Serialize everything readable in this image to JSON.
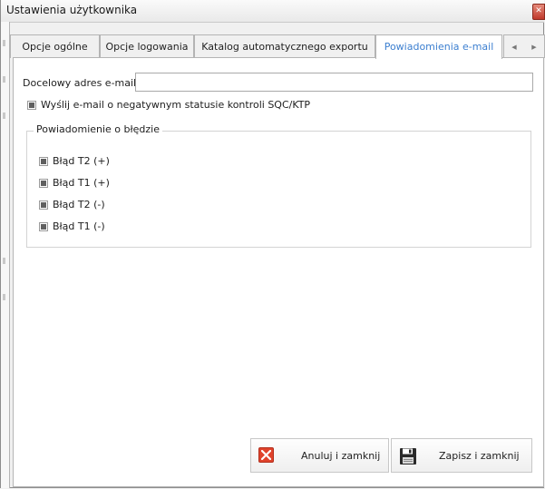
{
  "window": {
    "title": "Ustawienia użytkownika"
  },
  "tabs": [
    {
      "label": "Opcje ogólne",
      "active": false
    },
    {
      "label": "Opcje logowania",
      "active": false
    },
    {
      "label": "Katalog automatycznego exportu",
      "active": false
    },
    {
      "label": "Powiadomienia e-mail",
      "active": true
    }
  ],
  "email": {
    "label": "Docelowy adres e-mail",
    "value": ""
  },
  "send_on_negative": {
    "label": "Wyślij e-mail o negatywnym statusie kontroli SQC/KTP",
    "checked": "indeterminate"
  },
  "error_group": {
    "title": "Powiadomienie o błędzie",
    "items": [
      {
        "label": "Błąd T2 (+)",
        "checked": "indeterminate"
      },
      {
        "label": "Błąd T1 (+)",
        "checked": "indeterminate"
      },
      {
        "label": "Błąd T2 (-)",
        "checked": "indeterminate"
      },
      {
        "label": "Błąd T1 (-)",
        "checked": "indeterminate"
      }
    ]
  },
  "buttons": {
    "cancel": {
      "label": "Anuluj i zamknij",
      "icon": "close-icon"
    },
    "save": {
      "label": "Zapisz i zamknij",
      "icon": "floppy-disk-icon"
    }
  },
  "colors": {
    "active_tab_text": "#3c7fd0",
    "cancel_icon": "#e0432c"
  }
}
